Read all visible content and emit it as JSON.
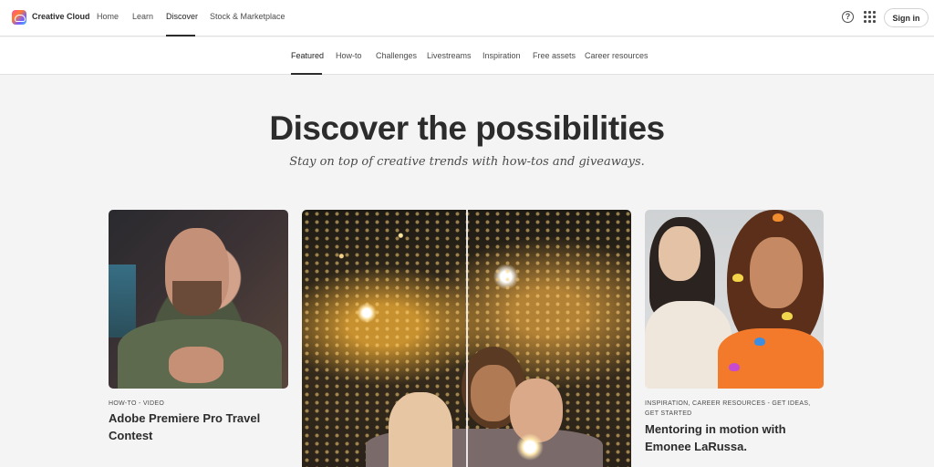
{
  "header": {
    "brand": "Creative Cloud",
    "nav": [
      {
        "label": "Home"
      },
      {
        "label": "Learn"
      },
      {
        "label": "Discover"
      },
      {
        "label": "Stock & Marketplace"
      }
    ],
    "help_icon": "help-circle-icon",
    "apps_icon": "app-grid-icon",
    "help_glyph": "?",
    "sign_in": "Sign in"
  },
  "subnav": {
    "items": [
      {
        "label": "Featured"
      },
      {
        "label": "How-to"
      },
      {
        "label": "Challenges"
      },
      {
        "label": "Livestreams"
      },
      {
        "label": "Inspiration"
      },
      {
        "label": "Free assets"
      },
      {
        "label": "Career resources"
      }
    ],
    "active": "Featured"
  },
  "hero": {
    "title": "Discover the possibilities",
    "subtitle": "Stay on top of creative trends with how-tos and giveaways."
  },
  "cards": [
    {
      "meta": "HOW-TO - VIDEO",
      "title_line1": "Adobe Premiere Pro Travel",
      "title_line2": "Contest"
    },
    {
      "meta": "",
      "title_line1": "",
      "title_line2": ""
    },
    {
      "meta_line1": "INSPIRATION, CAREER RESOURCES - GET IDEAS,",
      "meta_line2": "GET STARTED",
      "title_line1": "Mentoring in motion with",
      "title_line2": "Emonee LaRussa."
    }
  ]
}
